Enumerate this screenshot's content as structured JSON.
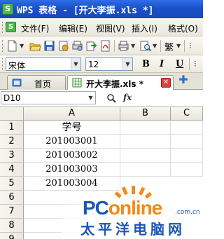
{
  "window": {
    "title": "WPS 表格 - [开大李振.xls *]",
    "logo_letter": "S"
  },
  "menu": {
    "items": [
      "文件(F)",
      "编辑(E)",
      "视图(V)",
      "插入(I)",
      "格式(O)"
    ]
  },
  "toolbar": {
    "icons": [
      "new-icon",
      "open-icon",
      "save-icon",
      "permission-icon",
      "print-preview-icon",
      "export-icon",
      "pdf-icon",
      "print-icon",
      "find-icon"
    ],
    "traditional_label": "繁"
  },
  "format": {
    "font_name": "宋体",
    "font_size": "12",
    "bold": "B",
    "italic": "I",
    "underline": "U"
  },
  "tabs": [
    {
      "label": "首页",
      "active": false
    },
    {
      "label": "开大李振.xls *",
      "active": true
    }
  ],
  "formula_bar": {
    "name_box": "D10",
    "fx_label": "fx",
    "formula": ""
  },
  "sheet": {
    "columns": [
      "A",
      "B",
      "C"
    ],
    "rows": [
      "1",
      "2",
      "3",
      "4",
      "5",
      "6",
      "7",
      "8",
      "9"
    ],
    "cells_a": [
      "学号",
      "201003001",
      "201003002",
      "201003003",
      "201003004",
      "",
      "",
      "",
      ""
    ]
  },
  "watermark": {
    "brand_part1": "PC",
    "brand_part2": "online",
    "domain": ".com.cn",
    "chinese": "太平洋电脑网",
    "colors": {
      "blue": "#1a56b8",
      "orange": "#f08a1c"
    }
  }
}
